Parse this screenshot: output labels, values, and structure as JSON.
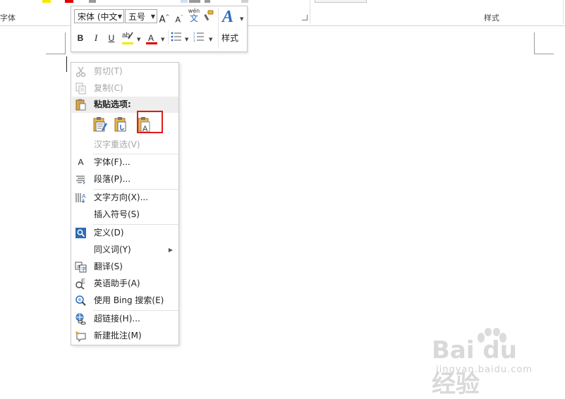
{
  "ribbon": {
    "font_group_label": "字体",
    "styles_group_label": "样式"
  },
  "mini_toolbar": {
    "font_name": "宋体 (中文",
    "font_size": "五号",
    "grow_font_label": "A",
    "shrink_font_label": "A",
    "phonetic_guide_label": "wén",
    "phonetic_guide_char": "文",
    "bold_label": "B",
    "italic_label": "I",
    "underline_label": "U",
    "font_color_label": "A",
    "styles_label": "样式",
    "styles_glyph": "A",
    "highlight_color": "#f5e800",
    "font_color": "#e00000"
  },
  "context_menu": {
    "cut": "剪切(T)",
    "copy": "复制(C)",
    "paste_options_header": "粘贴选项:",
    "reconvert": "汉字重选(V)",
    "font": "字体(F)...",
    "paragraph": "段落(P)...",
    "text_direction": "文字方向(X)...",
    "insert_symbol": "插入符号(S)",
    "define": "定义(D)",
    "synonyms": "同义词(Y)",
    "translate": "翻译(S)",
    "english_assistant": "英语助手(A)",
    "bing_search": "使用 Bing 搜索(E)",
    "hyperlink": "超链接(H)...",
    "new_comment": "新建批注(M)",
    "font_icon_glyph": "A"
  },
  "watermark": {
    "logo": "Bai du 经验",
    "site": "jingyan.baidu.com"
  }
}
